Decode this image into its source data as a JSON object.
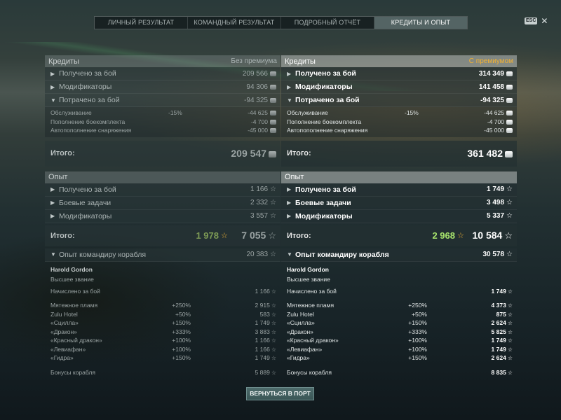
{
  "tabs": [
    {
      "label": "ЛИЧНЫЙ РЕЗУЛЬТАТ",
      "active": false
    },
    {
      "label": "КОМАНДНЫЙ РЕЗУЛЬТАТ",
      "active": false
    },
    {
      "label": "ПОДРОБНЫЙ ОТЧЁТ",
      "active": false
    },
    {
      "label": "КРЕДИТЫ И ОПЫТ",
      "active": true
    }
  ],
  "esc": {
    "label": "ESC",
    "close": "✕"
  },
  "left": {
    "credits_header": "Кредиты",
    "mode": "Без премиума",
    "credit_rows": [
      {
        "arrow": "▶",
        "label": "Получено за бой",
        "value": "209 566"
      },
      {
        "arrow": "▶",
        "label": "Модификаторы",
        "value": "94 306"
      },
      {
        "arrow": "▼",
        "label": "Потрачено за бой",
        "value": "-94 325"
      }
    ],
    "spent": [
      {
        "label": "Обслуживание",
        "pct": "-15%",
        "value": "-44 625"
      },
      {
        "label": "Пополнение боекомплекта",
        "pct": "",
        "value": "-4 700"
      },
      {
        "label": "Автопополнение снаряжения",
        "pct": "",
        "value": "-45 000"
      }
    ],
    "credits_total_label": "Итого:",
    "credits_total": "209 547",
    "xp_header": "Опыт",
    "xp_rows": [
      {
        "arrow": "▶",
        "label": "Получено за бой",
        "value": "1 166"
      },
      {
        "arrow": "▶",
        "label": "Боевые задачи",
        "value": "2 332"
      },
      {
        "arrow": "▶",
        "label": "Модификаторы",
        "value": "3 557"
      }
    ],
    "xp_total_label": "Итого:",
    "xp_free": "1 978",
    "xp_total": "7 055",
    "commander_label": "Опыт командиру корабля",
    "commander_value": "20 383",
    "commander_name": "Harold Gordon",
    "commander_rank": "Высшее звание",
    "accrued_label": "Начислено за бой",
    "accrued_value": "1 166",
    "bonuses": [
      {
        "label": "Мятежное пламя",
        "pct": "+250%",
        "value": "2 915"
      },
      {
        "label": "Zulu Hotel",
        "pct": "+50%",
        "value": "583"
      },
      {
        "label": "«Сцилла»",
        "pct": "+150%",
        "value": "1 749"
      },
      {
        "label": "«Дракон»",
        "pct": "+333%",
        "value": "3 883"
      },
      {
        "label": "«Красный дракон»",
        "pct": "+100%",
        "value": "1 166"
      },
      {
        "label": "«Левиафан»",
        "pct": "+100%",
        "value": "1 166"
      },
      {
        "label": "«Гидра»",
        "pct": "+150%",
        "value": "1 749"
      }
    ],
    "ship_bonus_label": "Бонусы корабля",
    "ship_bonus_value": "5 889"
  },
  "right": {
    "credits_header": "Кредиты",
    "mode": "С премиумом",
    "credit_rows": [
      {
        "arrow": "▶",
        "label": "Получено за бой",
        "value": "314 349"
      },
      {
        "arrow": "▶",
        "label": "Модификаторы",
        "value": "141 458"
      },
      {
        "arrow": "▼",
        "label": "Потрачено за бой",
        "value": "-94 325"
      }
    ],
    "spent": [
      {
        "label": "Обслуживание",
        "pct": "-15%",
        "value": "-44 625"
      },
      {
        "label": "Пополнение боекомплекта",
        "pct": "",
        "value": "-4 700"
      },
      {
        "label": "Автопополнение снаряжения",
        "pct": "",
        "value": "-45 000"
      }
    ],
    "credits_total_label": "Итого:",
    "credits_total": "361 482",
    "xp_header": "Опыт",
    "xp_rows": [
      {
        "arrow": "▶",
        "label": "Получено за бой",
        "value": "1 749"
      },
      {
        "arrow": "▶",
        "label": "Боевые задачи",
        "value": "3 498"
      },
      {
        "arrow": "▶",
        "label": "Модификаторы",
        "value": "5 337"
      }
    ],
    "xp_total_label": "Итого:",
    "xp_free": "2 968",
    "xp_total": "10 584",
    "commander_label": "Опыт командиру корабля",
    "commander_value": "30 578",
    "commander_name": "Harold Gordon",
    "commander_rank": "Высшее звание",
    "accrued_label": "Начислено за бой",
    "accrued_value": "1 749",
    "bonuses": [
      {
        "label": "Мятежное пламя",
        "pct": "+250%",
        "value": "4 373"
      },
      {
        "label": "Zulu Hotel",
        "pct": "+50%",
        "value": "875"
      },
      {
        "label": "«Сцилла»",
        "pct": "+150%",
        "value": "2 624"
      },
      {
        "label": "«Дракон»",
        "pct": "+333%",
        "value": "5 825"
      },
      {
        "label": "«Красный дракон»",
        "pct": "+100%",
        "value": "1 749"
      },
      {
        "label": "«Левиафан»",
        "pct": "+100%",
        "value": "1 749"
      },
      {
        "label": "«Гидра»",
        "pct": "+150%",
        "value": "2 624"
      }
    ],
    "ship_bonus_label": "Бонусы корабля",
    "ship_bonus_value": "8 835"
  },
  "return_button": "ВЕРНУТЬСЯ В ПОРТ",
  "icons": {
    "credit": "credit-coin-icon",
    "xp": "xp-star-icon",
    "free_xp": "free-xp-star-icon"
  },
  "colors": {
    "premium_accent": "#f2b233",
    "free_xp_green": "#a6e26c",
    "active_tab": "#6e8280"
  }
}
